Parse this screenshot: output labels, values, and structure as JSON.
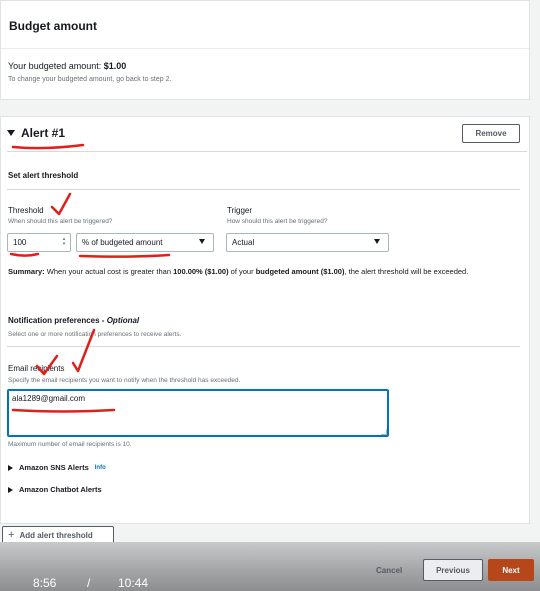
{
  "budget": {
    "header": "Budget amount",
    "amount_label": "Your budgeted amount:",
    "amount_value": "$1.00",
    "note": "To change your budgeted amount, go back to step 2."
  },
  "alert": {
    "title": "Alert #1",
    "remove_label": "Remove",
    "threshold_section": "Set alert threshold",
    "threshold": {
      "label": "Threshold",
      "desc": "When should this alert be triggered?",
      "value": "100",
      "unit_selected": "% of budgeted amount"
    },
    "trigger": {
      "label": "Trigger",
      "desc": "How should this alert be triggered?",
      "selected": "Actual"
    },
    "summary": {
      "label": "Summary:",
      "text1": "When your actual cost is greater than",
      "pct": "100.00% ($1.00)",
      "text2": "of your",
      "budget_ref": "budgeted amount ($1.00)",
      "text3": ", the alert threshold will be exceeded."
    },
    "notifications": {
      "title": "Notification preferences -",
      "optional": "Optional",
      "desc": "Select one or more notification preferences to receive alerts."
    },
    "email": {
      "label": "Email recipients",
      "desc": "Specify the email recipients you want to notify when the threshold has exceeded.",
      "value": "ala1289@gmail.com",
      "max_note": "Maximum number of email recipients is 10."
    },
    "sns": {
      "label": "Amazon SNS Alerts",
      "info": "Info"
    },
    "chatbot": {
      "label": "Amazon Chatbot Alerts"
    }
  },
  "add_threshold_label": "Add alert threshold",
  "footer": {
    "cancel_label": "Cancel",
    "previous_label": "Previous",
    "next_label": "Next"
  },
  "video": {
    "current_time": "8:56",
    "separator": "/",
    "total_time": "10:44"
  },
  "colors": {
    "primary_orange": "#b5471b",
    "focus_blue": "#0073bb",
    "annotation_red": "#e0201b"
  }
}
